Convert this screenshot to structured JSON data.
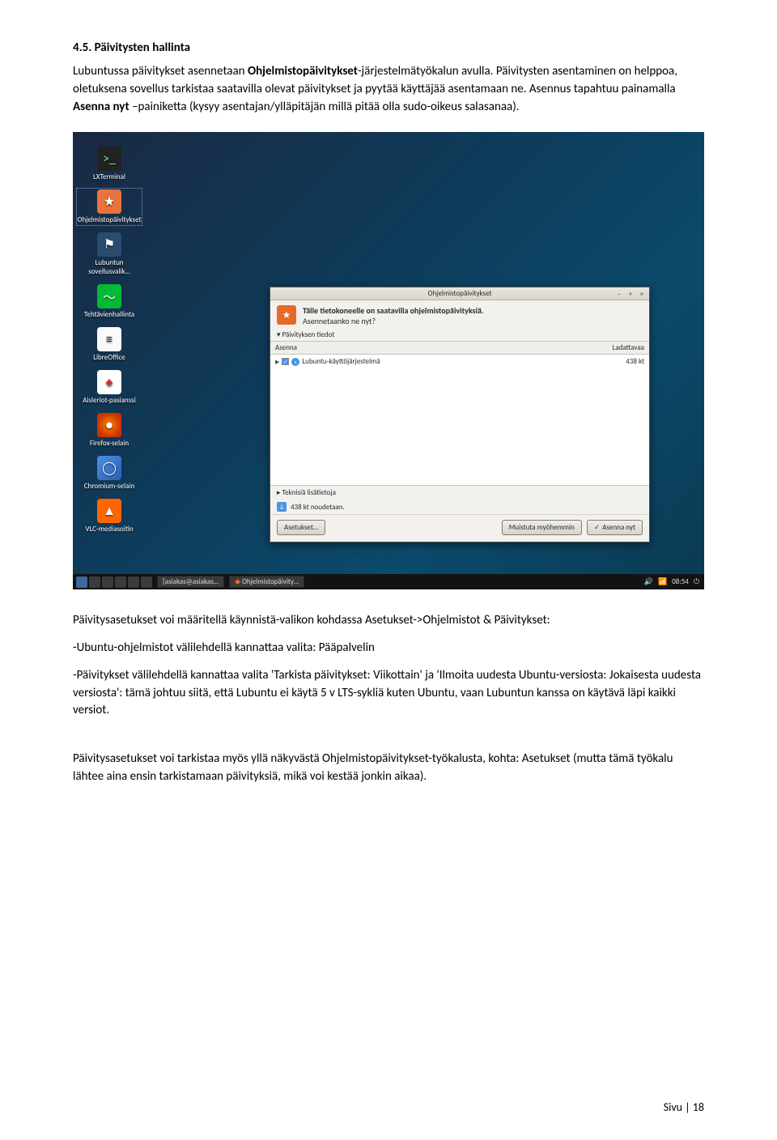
{
  "heading": "4.5.  Päivitysten hallinta",
  "para1_a": "Lubuntussa päivitykset asennetaan ",
  "para1_b": "Ohjelmistopäivitykset",
  "para1_c": "-järjestelmätyökalun avulla. Päivitysten asentaminen on helppoa, oletuksena sovellus tarkistaa saatavilla olevat päivitykset ja pyytää käyttäjää asentamaan ne. Asennus tapahtuu painamalla ",
  "para1_d": "Asenna nyt",
  "para1_e": " –painiketta (kysyy asentajan/ylläpitäjän millä pitää olla sudo-oikeus salasanaa).",
  "desktop": {
    "items": [
      {
        "label": "LXTerminal",
        "cls": "ic-term",
        "glyph": ">_"
      },
      {
        "label": "Ohjelmistopäivitykset",
        "cls": "ic-upd",
        "glyph": "★"
      },
      {
        "label": "Lubuntun sovellusvalik…",
        "cls": "ic-store",
        "glyph": "⚑"
      },
      {
        "label": "Tehtävienhallinta",
        "cls": "ic-task",
        "glyph": "〜"
      },
      {
        "label": "LibreOffice",
        "cls": "ic-libre",
        "glyph": "≡"
      },
      {
        "label": "Aisleriot-pasianssi",
        "cls": "ic-cards",
        "glyph": "♠"
      },
      {
        "label": "Firefox-selain",
        "cls": "ic-ff",
        "glyph": "●"
      },
      {
        "label": "Chromium-selain",
        "cls": "ic-chr",
        "glyph": "◯"
      },
      {
        "label": "VLC-mediasoitin",
        "cls": "ic-vlc",
        "glyph": "▲"
      }
    ]
  },
  "window": {
    "title": "Ohjelmistopäivitykset",
    "banner_line1": "Tälle tietokoneelle on saatavilla ohjelmistopäivityksiä.",
    "banner_line2": "Asennetaanko ne nyt?",
    "disclosure": "▾ Päivityksen tiedot",
    "col1": "Asenna",
    "col2": "Ladattavaa",
    "row_text": "Lubuntu-käyttöjärjestelmä",
    "row_size": "438 kt",
    "tech": "▸ Teknisiä lisätietoja",
    "download": "438 kt noudetaan.",
    "btn_settings": "Asetukset…",
    "btn_later": "Muistuta myöhemmin",
    "btn_install": "Asenna nyt"
  },
  "taskbar": {
    "task1": "[asiakas@asiakas…",
    "task2": "Ohjelmistopäivity…",
    "time": "08:54"
  },
  "para2": "Päivitysasetukset voi määritellä käynnistä-valikon kohdassa Asetukset->Ohjelmistot & Päivitykset:",
  "bullet1": "-Ubuntu-ohjelmistot välilehdellä kannattaa valita: Pääpalvelin",
  "bullet2": "-Päivitykset välilehdellä kannattaa valita 'Tarkista päivitykset: Viikottain' ja 'Ilmoita uudesta Ubuntu-versiosta: Jokaisesta uudesta versiosta': tämä johtuu siitä, että Lubuntu ei käytä 5 v LTS-sykliä kuten Ubuntu, vaan Lubuntun kanssa on käytävä läpi kaikki versiot.",
  "para3": "Päivitysasetukset voi tarkistaa myös yllä näkyvästä Ohjelmistopäivitykset-työkalusta, kohta: Asetukset (mutta tämä työkalu lähtee aina ensin tarkistamaan päivityksiä, mikä voi kestää jonkin aikaa).",
  "footer": "Sivu | 18"
}
